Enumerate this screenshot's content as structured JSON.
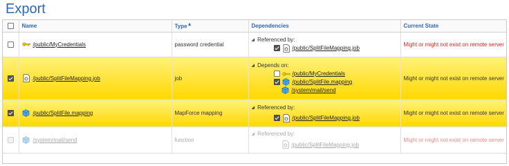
{
  "page": {
    "title": "Export"
  },
  "columns": {
    "name": "Name",
    "type": "Type",
    "dependencies": "Dependencies",
    "state": "Current State"
  },
  "rows": [
    {
      "checked": false,
      "name": "/public/MyCredentials",
      "icon": "key-icon",
      "type": "password credential",
      "dep_header": "Referenced by:",
      "deps": [
        {
          "checked": true,
          "icon": "job-icon",
          "label": "/public/SplitFileMapping.job"
        }
      ],
      "state": "Might or might not exist on remote server"
    },
    {
      "checked": true,
      "name": "/public/SplitFileMapping.job",
      "icon": "job-icon",
      "type": "job",
      "dep_header": "Depends on:",
      "deps": [
        {
          "checked": false,
          "icon": "key-icon",
          "label": "/public/MyCredentials"
        },
        {
          "checked": true,
          "icon": "mapping-icon",
          "label": "/public/SplitFile.mapping"
        },
        {
          "checked": null,
          "icon": "mapping-icon",
          "label": "/system/mail/send"
        }
      ],
      "state": "Might or might not exist on remote server"
    },
    {
      "checked": true,
      "name": "/public/SplitFile.mapping",
      "icon": "mapping-icon",
      "type": "MapForce mapping",
      "dep_header": "Referenced by:",
      "deps": [
        {
          "checked": true,
          "icon": "job-icon",
          "label": "/public/SplitFileMapping.job"
        }
      ],
      "state": "Might or might not exist on remote server"
    },
    {
      "checked": false,
      "name": "/system/mail/send",
      "icon": "mapping-icon",
      "type": "function",
      "dep_header": "Referenced by:",
      "deps": [
        {
          "checked": null,
          "icon": "job-icon",
          "label": "/public/SplitFileMapping.job"
        }
      ],
      "state": "Might or might not exist on remote server"
    }
  ],
  "colors": {
    "accent": "#2e66b8",
    "selected_row": "#ffe74a",
    "state_red": "#e02020"
  }
}
